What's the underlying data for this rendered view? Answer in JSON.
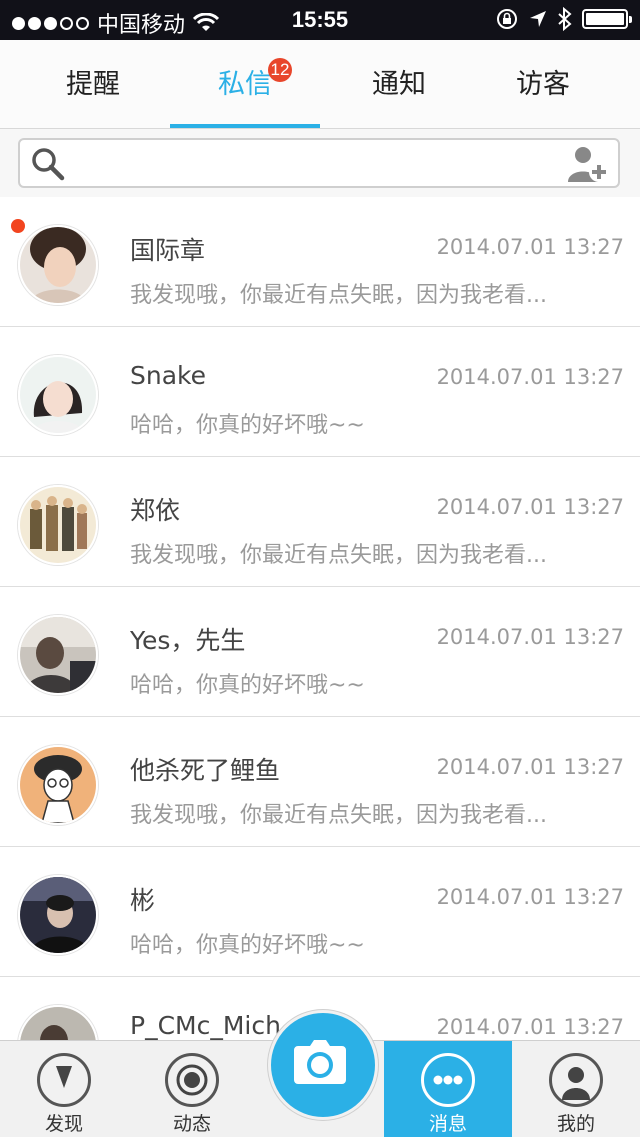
{
  "status_bar": {
    "carrier": "中国移动",
    "time": "15:55",
    "signal_icon": "signal-dots-icon",
    "wifi_icon": "wifi-icon",
    "lock_icon": "rotation-lock-icon",
    "location_icon": "location-arrow-icon",
    "bluetooth_icon": "bluetooth-icon",
    "battery_icon": "battery-icon"
  },
  "tabs": [
    {
      "label": "提醒"
    },
    {
      "label": "私信",
      "badge": "12",
      "active": true
    },
    {
      "label": "通知"
    },
    {
      "label": "访客"
    }
  ],
  "search": {
    "placeholder": "",
    "search_icon": "search-icon",
    "add_icon": "add-friend-icon"
  },
  "messages": [
    {
      "name": "国际章",
      "time": "2014.07.01  13:27",
      "preview": "我发现哦，你最近有点失眠，因为我老看...",
      "unread": true
    },
    {
      "name": "Snake",
      "time": "2014.07.01  13:27",
      "preview": "哈哈，你真的好坏哦~~"
    },
    {
      "name": "郑依",
      "time": "2014.07.01  13:27",
      "preview": "我发现哦，你最近有点失眠，因为我老看..."
    },
    {
      "name": "Yes，先生",
      "time": "2014.07.01  13:27",
      "preview": "哈哈，你真的好坏哦~~"
    },
    {
      "name": "他杀死了鲤鱼",
      "time": "2014.07.01  13:27",
      "preview": "我发现哦，你最近有点失眠，因为我老看..."
    },
    {
      "name": "彬",
      "time": "2014.07.01  13:27",
      "preview": "哈哈，你真的好坏哦~~"
    },
    {
      "name": "P_CMc_Mich",
      "time": "2014.07.01  13:27",
      "preview": ""
    }
  ],
  "bottom_nav": [
    {
      "label": "发现",
      "icon": "discover-icon"
    },
    {
      "label": "动态",
      "icon": "feed-icon"
    },
    {
      "label": "消息",
      "icon": "messages-icon",
      "active": true
    },
    {
      "label": "我的",
      "icon": "profile-icon"
    }
  ],
  "camera": {
    "icon": "camera-icon"
  },
  "colors": {
    "accent": "#2bb0e6",
    "badge": "#e8462b",
    "unread": "#f2451f"
  }
}
